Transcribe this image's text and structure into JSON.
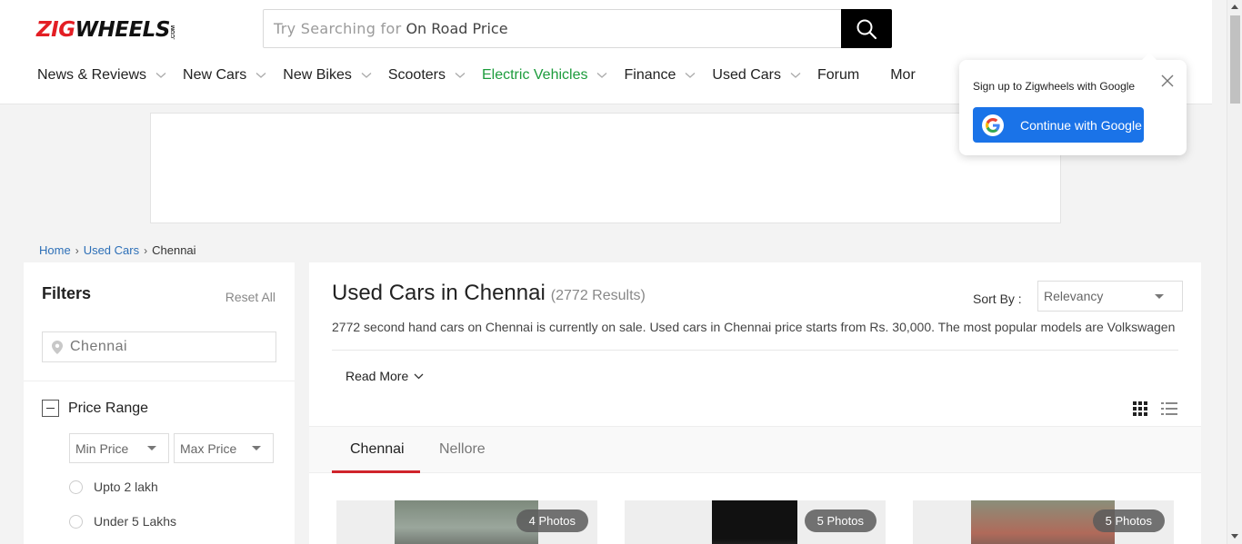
{
  "brand": {
    "zig": "ZIG",
    "wheels": "WHEELS",
    "com": ".COM"
  },
  "search": {
    "placeholder_prefix": "Try Searching for",
    "placeholder_suffix": "On Road Price"
  },
  "nav": {
    "items": [
      {
        "label": "News & Reviews",
        "has_dropdown": true
      },
      {
        "label": "New Cars",
        "has_dropdown": true
      },
      {
        "label": "New Bikes",
        "has_dropdown": true
      },
      {
        "label": "Scooters",
        "has_dropdown": true
      },
      {
        "label": "Electric Vehicles",
        "has_dropdown": true,
        "color": "#1c9c3c"
      },
      {
        "label": "Finance",
        "has_dropdown": true
      },
      {
        "label": "Used Cars",
        "has_dropdown": true
      },
      {
        "label": "Forum",
        "has_dropdown": false
      },
      {
        "label": "Mor",
        "has_dropdown": false
      }
    ]
  },
  "popup": {
    "text": "Sign up to Zigwheels with Google",
    "button": "Continue with Google"
  },
  "breadcrumb": {
    "home": "Home",
    "used_cars": "Used Cars",
    "current": "Chennai"
  },
  "filters": {
    "title": "Filters",
    "reset": "Reset All",
    "city_placeholder": "Chennai",
    "price_range": {
      "title": "Price Range",
      "min_placeholder": "Min Price",
      "max_placeholder": "Max Price",
      "options": [
        "Upto 2 lakh",
        "Under 5 Lakhs"
      ]
    }
  },
  "main": {
    "title": "Used Cars in Chennai",
    "results": "(2772 Results)",
    "sort_label": "Sort By :",
    "sort_value": "Relevancy",
    "description": "2772 second hand cars on Chennai is currently on sale. Used cars in Chennai price starts from Rs. 30,000. The most popular models are Volkswagen",
    "read_more": "Read More",
    "tabs": [
      "Chennai",
      "Nellore"
    ],
    "cards": [
      {
        "photos": "4 Photos"
      },
      {
        "photos": "5 Photos"
      },
      {
        "photos": "5 Photos"
      }
    ]
  },
  "colors": {
    "brand_red": "#e31e24",
    "accent_green": "#1c9c3c",
    "google_blue": "#1a73e8",
    "tab_underline": "#d0242b"
  }
}
